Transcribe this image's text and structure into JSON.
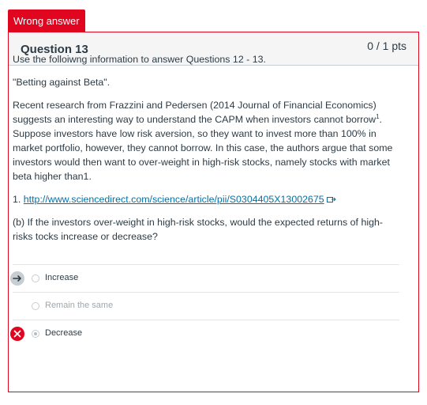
{
  "status_tab": "Wrong answer",
  "question": {
    "title": "Question 13",
    "points": "0 / 1 pts"
  },
  "body": {
    "intro": "Use the folloiwng information to answer Questions 12 - 13.",
    "heading": "\"Betting against Beta\".",
    "para_main": "Recent research from Frazzini and Pedersen (2014 Journal of Financial Economics) suggests an interesting way to understand the CAPM when investors cannot borrow",
    "para_sup": "1",
    "para_tail": ". Suppose investors have low risk aversion, so they want to invest more than 100% in market portfolio, however, they cannot borrow. In this case, the authors argue that some investors would then want to over-weight in high-risk stocks, namely stocks with market beta higher than1.",
    "footnote_num": "1. ",
    "footnote_link": "http://www.sciencedirect.com/science/article/pii/S0304405X13002675",
    "prompt": "(b) If the investors over-weight in high-risk stocks, would the expected returns of high-risks tocks increase or decrease?"
  },
  "answers": [
    {
      "label": "Increase",
      "marker": "correct-arrow-icon",
      "selected": false
    },
    {
      "label": "Remain the same",
      "marker": "",
      "selected": false
    },
    {
      "label": "Decrease",
      "marker": "wrong-x-icon",
      "selected": true
    }
  ],
  "colors": {
    "accent_red": "#e0061f",
    "link": "#0770a3",
    "text": "#2d3b45"
  }
}
